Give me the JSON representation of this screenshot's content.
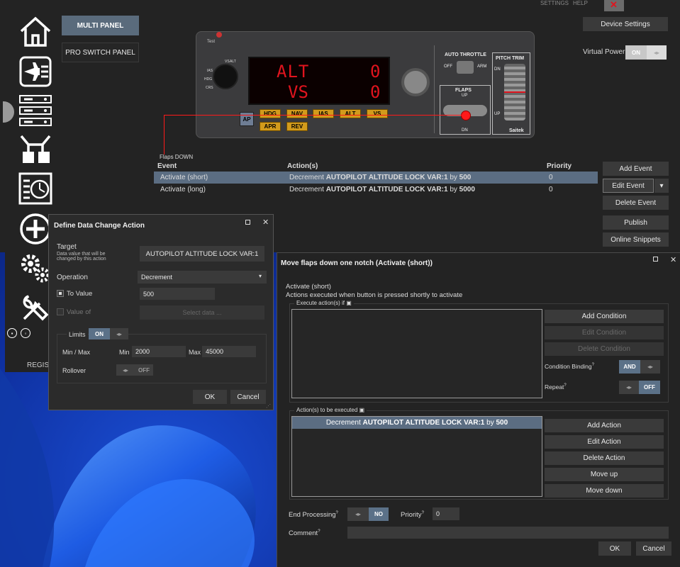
{
  "topbar": {
    "settings": "SETTINGS",
    "help": "HELP"
  },
  "panels": {
    "multi": "MULTI PANEL",
    "pro_switch": "PRO SWITCH PANEL"
  },
  "device_settings": "Device Settings",
  "virtual_power": {
    "label": "Virtual Power",
    "state": "ON"
  },
  "sidebar": {
    "register": "REGIST"
  },
  "hardware": {
    "display_top": {
      "label": "ALT",
      "value": "0"
    },
    "display_bottom": {
      "label": "VS",
      "value": "0"
    },
    "test_label": "Test",
    "knob_labels": [
      "VS",
      "IAS",
      "HDG",
      "CRS",
      "ALT"
    ],
    "buttons_row1": [
      "HDG",
      "NAV",
      "IAS",
      "ALT",
      "VS"
    ],
    "buttons_row2": [
      "APR",
      "REV"
    ],
    "ap_button": "AP",
    "auto_throttle": {
      "title": "AUTO THROTTLE",
      "off": "OFF",
      "arm": "ARM"
    },
    "flaps": {
      "title": "FLAPS",
      "up": "UP",
      "dn": "DN"
    },
    "pitch_trim": {
      "title": "PITCH TRIM",
      "dn": "DN",
      "up": "UP"
    },
    "brand": "Saitek"
  },
  "events_section": {
    "title": "Flaps DOWN",
    "headers": {
      "event": "Event",
      "actions": "Action(s)",
      "priority": "Priority"
    },
    "rows": [
      {
        "event": "Activate (short)",
        "verb": "Decrement",
        "var": "AUTOPILOT ALTITUDE LOCK VAR:1",
        "by": "by",
        "amount": "500",
        "priority": "0"
      },
      {
        "event": "Activate (long)",
        "verb": "Decrement",
        "var": "AUTOPILOT ALTITUDE LOCK VAR:1",
        "by": "by",
        "amount": "5000",
        "priority": "0"
      }
    ],
    "buttons": {
      "add": "Add Event",
      "edit": "Edit Event",
      "delete": "Delete Event",
      "publish": "Publish",
      "snippets": "Online Snippets"
    }
  },
  "data_change_dialog": {
    "title": "Define Data Change Action",
    "target_label": "Target",
    "target_desc": "Data value that will be changed by this action",
    "target_value": "AUTOPILOT ALTITUDE LOCK VAR:1",
    "operation_label": "Operation",
    "operation_value": "Decrement",
    "to_value_label": "To Value",
    "to_value": "500",
    "value_of_label": "Value of",
    "select_data": "Select data ...",
    "limits_label": "Limits",
    "limits_state": "ON",
    "minmax_label": "Min / Max",
    "min_label": "Min",
    "min_value": "2000",
    "max_label": "Max",
    "max_value": "45000",
    "rollover_label": "Rollover",
    "rollover_state": "OFF",
    "ok": "OK",
    "cancel": "Cancel"
  },
  "move_flaps_dialog": {
    "title": "Move flaps down one notch (Activate (short))",
    "section": "Activate (short)",
    "section_desc": "Actions executed when button is pressed shortly to activate",
    "execute_if": "Execute action(s) if",
    "cond_buttons": {
      "add": "Add Condition",
      "edit": "Edit Condition",
      "delete": "Delete Condition"
    },
    "condition_binding": "Condition Binding",
    "binding_state": "AND",
    "repeat_label": "Repeat",
    "repeat_state": "OFF",
    "actions_label": "Action(s) to be executed",
    "action_item": {
      "verb": "Decrement",
      "var": "AUTOPILOT ALTITUDE LOCK VAR:1",
      "by": "by",
      "amount": "500"
    },
    "action_buttons": {
      "add": "Add Action",
      "edit": "Edit Action",
      "delete": "Delete Action",
      "up": "Move up",
      "down": "Move down"
    },
    "end_processing": "End Processing",
    "end_state": "NO",
    "priority_label": "Priority",
    "priority_value": "0",
    "comment_label": "Comment",
    "ok": "OK",
    "cancel": "Cancel"
  },
  "colors": {
    "accent": "#566b82",
    "selection": "#5b6d82",
    "led": "#e0141e",
    "panel_button": "#d29b1c"
  }
}
